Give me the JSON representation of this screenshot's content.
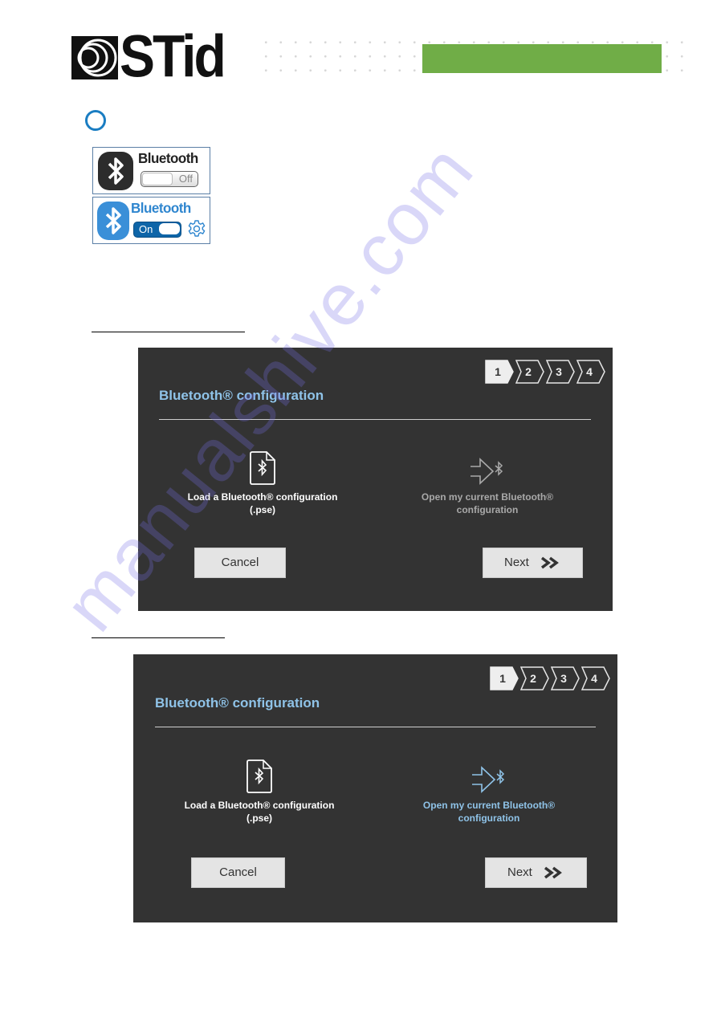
{
  "header": {
    "brand": "STid",
    "accent_color": "#70ad47"
  },
  "bluetooth_cards": [
    {
      "state": "off",
      "word": "Bluetooth",
      "toggle_label": "Off"
    },
    {
      "state": "on",
      "word": "Bluetooth",
      "toggle_label": "On"
    }
  ],
  "dialogs": [
    {
      "title": "Bluetooth® configuration",
      "steps": [
        "1",
        "2",
        "3",
        "4"
      ],
      "active_step": "1",
      "options": {
        "load": {
          "line1": "Load a Bluetooth® configuration",
          "line2": "(.pse)"
        },
        "open": {
          "line1": "Open my current Bluetooth®",
          "line2": "configuration",
          "enabled": false
        }
      },
      "buttons": {
        "cancel": "Cancel",
        "next": "Next"
      }
    },
    {
      "title": "Bluetooth® configuration",
      "steps": [
        "1",
        "2",
        "3",
        "4"
      ],
      "active_step": "1",
      "options": {
        "load": {
          "line1": "Load a Bluetooth® configuration",
          "line2": "(.pse)"
        },
        "open": {
          "line1": "Open my current Bluetooth®",
          "line2": "configuration",
          "enabled": true
        }
      },
      "buttons": {
        "cancel": "Cancel",
        "next": "Next"
      }
    }
  ],
  "watermark": "manualshive.com"
}
